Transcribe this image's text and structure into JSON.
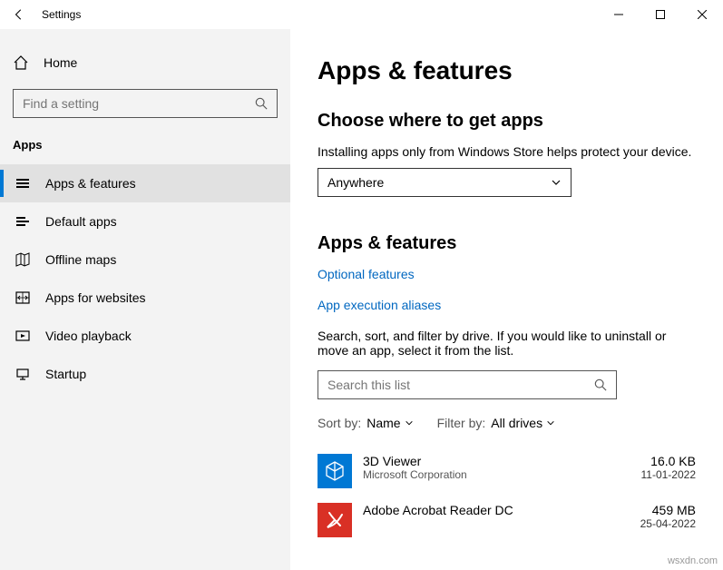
{
  "titlebar": {
    "back": "←",
    "title": "Settings"
  },
  "sidebar": {
    "home": "Home",
    "search_placeholder": "Find a setting",
    "category": "Apps",
    "items": [
      {
        "label": "Apps & features"
      },
      {
        "label": "Default apps"
      },
      {
        "label": "Offline maps"
      },
      {
        "label": "Apps for websites"
      },
      {
        "label": "Video playback"
      },
      {
        "label": "Startup"
      }
    ]
  },
  "main": {
    "title": "Apps & features",
    "choose": {
      "heading": "Choose where to get apps",
      "desc": "Installing apps only from Windows Store helps protect your device.",
      "value": "Anywhere"
    },
    "sub": {
      "heading": "Apps & features",
      "link1": "Optional features",
      "link2": "App execution aliases",
      "desc": "Search, sort, and filter by drive. If you would like to uninstall or move an app, select it from the list.",
      "search_placeholder": "Search this list",
      "sort_label": "Sort by:",
      "sort_value": "Name",
      "filter_label": "Filter by:",
      "filter_value": "All drives"
    },
    "apps": [
      {
        "name": "3D Viewer",
        "publisher": "Microsoft Corporation",
        "size": "16.0 KB",
        "date": "11-01-2022"
      },
      {
        "name": "Adobe Acrobat Reader DC",
        "publisher": "",
        "size": "459 MB",
        "date": "25-04-2022"
      }
    ]
  },
  "watermark": "wsxdn.com"
}
